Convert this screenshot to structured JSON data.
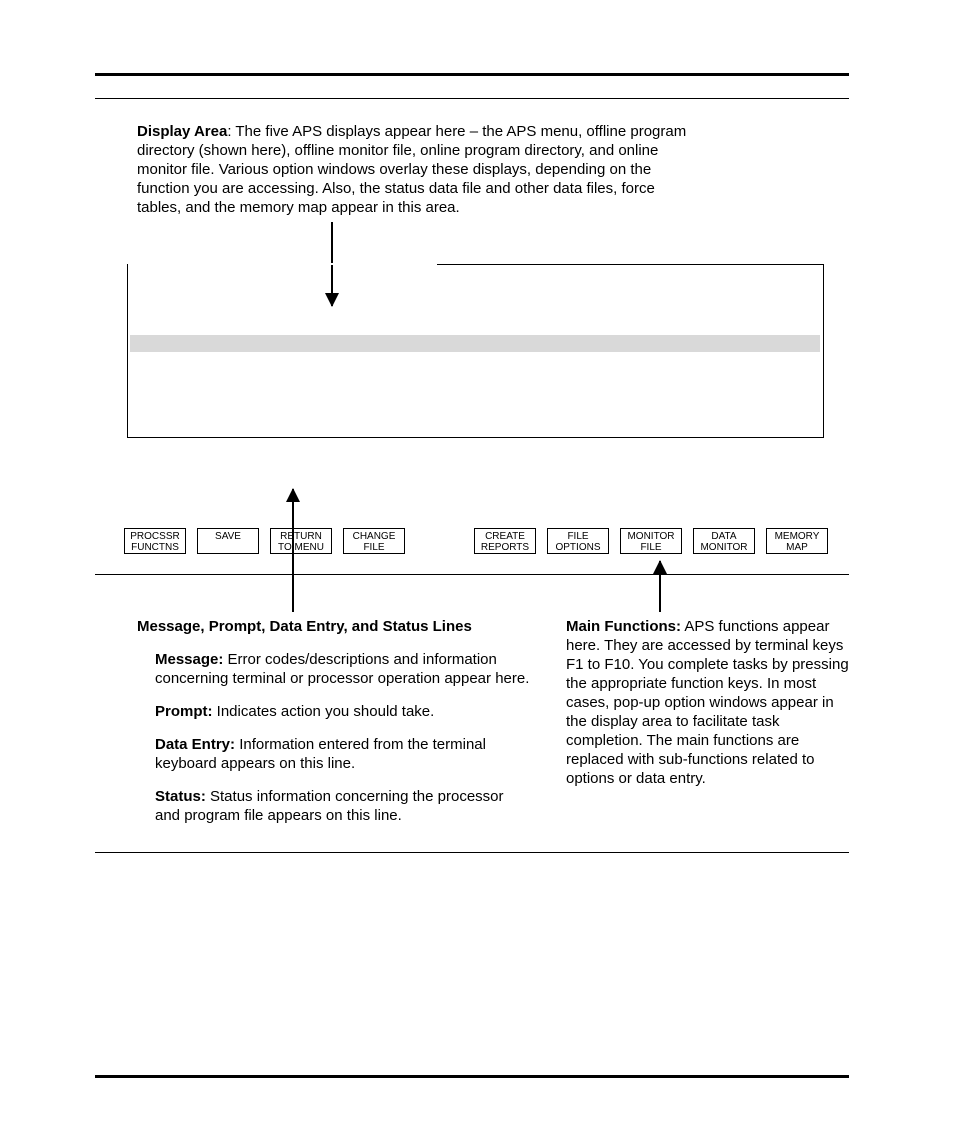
{
  "display_area": {
    "label": "Display Area",
    "text": ":  The five APS displays appear here – the APS menu, offline program directory (shown here), offline monitor file, online program directory, and online monitor file.  Various option windows overlay these displays, depending on the function you are accessing.  Also, the status data file and other data files, force tables, and the memory map appear in this area."
  },
  "fkeys": [
    {
      "l1": "PROCSSR",
      "l2": "FUNCTNS"
    },
    {
      "l1": "SAVE",
      "l2": ""
    },
    {
      "l1": "RETURN",
      "l2": "TO MENU"
    },
    {
      "l1": "CHANGE",
      "l2": "FILE"
    },
    {
      "l1": "CREATE",
      "l2": "REPORTS"
    },
    {
      "l1": "FILE",
      "l2": "OPTIONS"
    },
    {
      "l1": "MONITOR",
      "l2": "FILE"
    },
    {
      "l1": "DATA",
      "l2": "MONITOR"
    },
    {
      "l1": "MEMORY",
      "l2": "MAP"
    }
  ],
  "left": {
    "heading": "Message, Prompt, Data Entry, and Status Lines",
    "items": [
      {
        "b": "Message:",
        "t": "  Error codes/descriptions and information concerning terminal or processor operation appear here."
      },
      {
        "b": "Prompt:",
        "t": "  Indicates action you should take."
      },
      {
        "b": "Data Entry:",
        "t": "  Information entered from the terminal keyboard appears on this line."
      },
      {
        "b": "Status:",
        "t": "  Status information concerning the processor and program file appears on this line."
      }
    ]
  },
  "right": {
    "b": "Main Functions:",
    "t": "  APS functions appear here. They are accessed by terminal keys F1 to F10. You complete tasks by pressing the appropriate function keys.  In most cases, pop-up option windows appear in the display area to facilitate task completion.  The main functions are replaced with sub-functions related to options or data entry."
  }
}
